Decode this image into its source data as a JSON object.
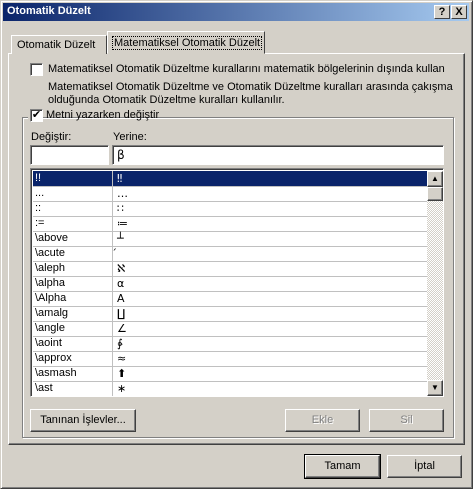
{
  "window": {
    "title": "Otomatik Düzelt",
    "help_glyph": "?",
    "close_glyph": "X"
  },
  "tabs": [
    {
      "label": "Otomatik Düzelt",
      "active": false
    },
    {
      "label": "Matematiksel Otomatik Düzelt",
      "active": true
    }
  ],
  "options": {
    "outside_math": {
      "checked": false,
      "label": "Matematiksel Otomatik Düzeltme kurallarını matematik bölgelerinin dışında kullan",
      "note_line1": "Matematiksel Otomatik Düzeltme ve Otomatik Düzeltme kuralları arasında çakışma",
      "note_line2": "olduğunda Otomatik Düzeltme kuralları kullanılır."
    },
    "replace_as_type": {
      "checked": true,
      "label": "Metni yazarken değiştir"
    }
  },
  "replace": {
    "replace_label": "Değiştir:",
    "with_label": "Yerine:",
    "replace_value": "",
    "with_value": "β"
  },
  "list": {
    "rows": [
      {
        "key": "!!",
        "value": "‼",
        "selected": true
      },
      {
        "key": "...",
        "value": "…"
      },
      {
        "key": "::",
        "value": "∷"
      },
      {
        "key": ":=",
        "value": "≔"
      },
      {
        "key": "\\above",
        "value": "┴"
      },
      {
        "key": "\\acute",
        "value": "́"
      },
      {
        "key": "\\aleph",
        "value": "ℵ"
      },
      {
        "key": "\\alpha",
        "value": "α"
      },
      {
        "key": "\\Alpha",
        "value": "Α"
      },
      {
        "key": "\\amalg",
        "value": "∐"
      },
      {
        "key": "\\angle",
        "value": "∠"
      },
      {
        "key": "\\aoint",
        "value": "∳"
      },
      {
        "key": "\\approx",
        "value": "≈"
      },
      {
        "key": "\\asmash",
        "value": "⬆"
      },
      {
        "key": "\\ast",
        "value": "∗"
      }
    ]
  },
  "buttons": {
    "recognized": "Tanınan İşlevler...",
    "add": "Ekle",
    "delete": "Sil",
    "ok": "Tamam",
    "cancel": "İptal"
  },
  "icons": {
    "scroll_up": "▲",
    "scroll_down": "▼",
    "check": "✔"
  }
}
